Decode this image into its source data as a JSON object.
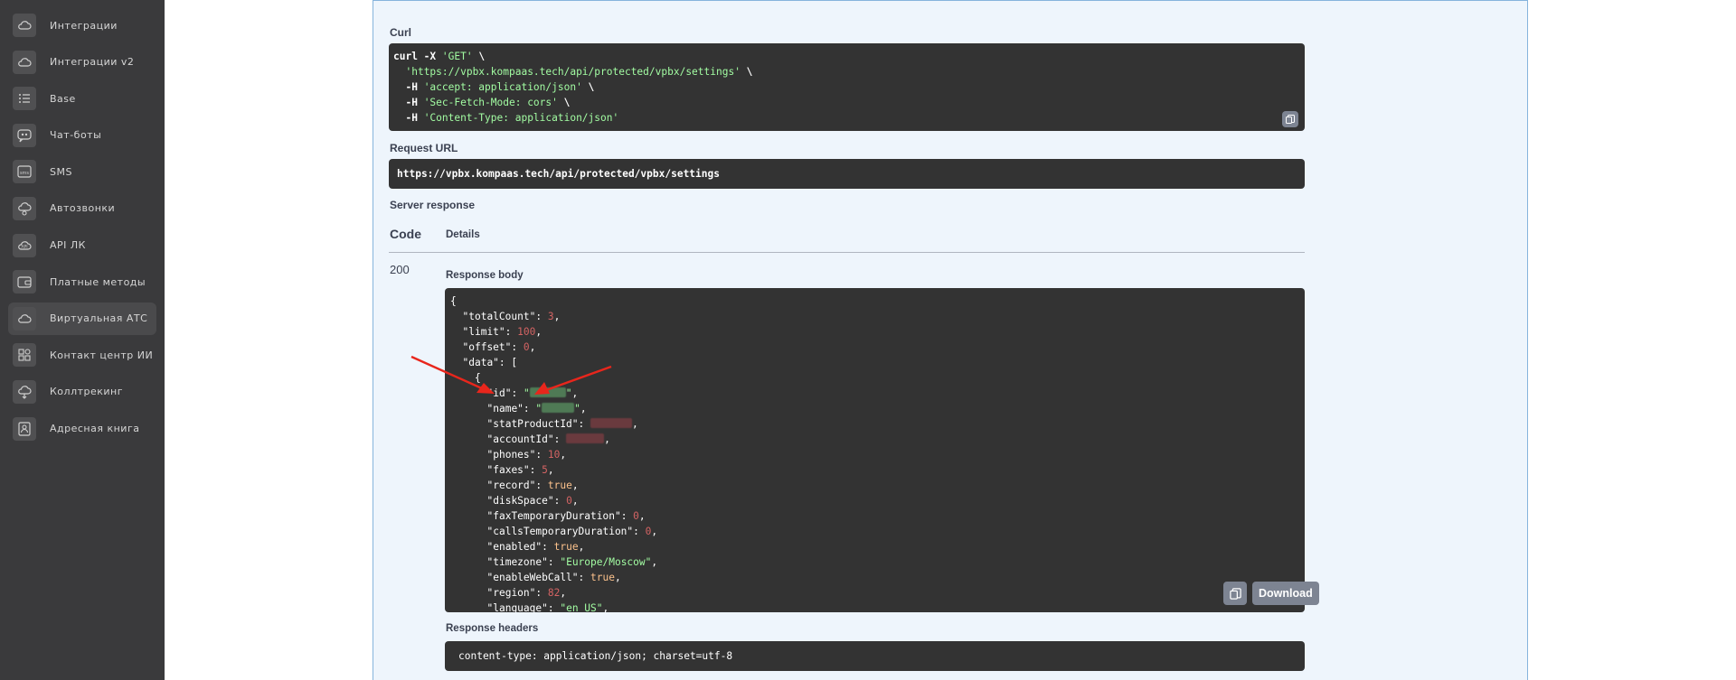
{
  "sidebar": {
    "items": [
      {
        "label": "Интеграции",
        "icon": "cloud-icon",
        "active": false
      },
      {
        "label": "Интеграции v2",
        "icon": "cloud-icon",
        "active": false
      },
      {
        "label": "Base",
        "icon": "list-icon",
        "active": false
      },
      {
        "label": "Чат-боты",
        "icon": "chatbot-icon",
        "active": false
      },
      {
        "label": "SMS",
        "icon": "sms-icon",
        "active": false
      },
      {
        "label": "Автозвонки",
        "icon": "autocall-icon",
        "active": false
      },
      {
        "label": "API ЛК",
        "icon": "api-icon",
        "active": false
      },
      {
        "label": "Платные методы",
        "icon": "wallet-icon",
        "active": false
      },
      {
        "label": "Виртуальная АТС",
        "icon": "cloud-icon",
        "active": true
      },
      {
        "label": "Контакт центр ИИ",
        "icon": "grid-icon",
        "active": false
      },
      {
        "label": "Коллтрекинг",
        "icon": "cloud-tracking-icon",
        "active": false
      },
      {
        "label": "Адресная книга",
        "icon": "address-book-icon",
        "active": false
      }
    ]
  },
  "curl": {
    "label": "Curl",
    "lines": [
      [
        "curl -X ",
        "'GET'",
        " \\"
      ],
      [
        "  ",
        "'https://vpbx.kompaas.tech/api/protected/vpbx/settings'",
        " \\"
      ],
      [
        "  -H ",
        "'accept: application/json'",
        " \\"
      ],
      [
        "  -H ",
        "'Sec-Fetch-Mode: cors'",
        " \\"
      ],
      [
        "  -H ",
        "'Content-Type: application/json'",
        ""
      ]
    ]
  },
  "request_url": {
    "label": "Request URL",
    "value": "https://vpbx.kompaas.tech/api/protected/vpbx/settings"
  },
  "server_response": {
    "label": "Server response",
    "code_header": "Code",
    "details_header": "Details",
    "code": "200",
    "response_body_label": "Response body",
    "download_label": "Download",
    "body_lines": [
      {
        "indent": 0,
        "parts": [
          [
            "p",
            "{"
          ]
        ]
      },
      {
        "indent": 2,
        "parts": [
          [
            "k",
            "\"totalCount\""
          ],
          [
            "p",
            ": "
          ],
          [
            "n",
            "3"
          ],
          [
            "p",
            ","
          ]
        ]
      },
      {
        "indent": 2,
        "parts": [
          [
            "k",
            "\"limit\""
          ],
          [
            "p",
            ": "
          ],
          [
            "n",
            "100"
          ],
          [
            "p",
            ","
          ]
        ]
      },
      {
        "indent": 2,
        "parts": [
          [
            "k",
            "\"offset\""
          ],
          [
            "p",
            ": "
          ],
          [
            "n",
            "0"
          ],
          [
            "p",
            ","
          ]
        ]
      },
      {
        "indent": 2,
        "parts": [
          [
            "k",
            "\"data\""
          ],
          [
            "p",
            ": ["
          ]
        ]
      },
      {
        "indent": 4,
        "parts": [
          [
            "p",
            "{"
          ]
        ]
      },
      {
        "indent": 6,
        "parts": [
          [
            "k",
            "\"id\""
          ],
          [
            "p",
            ": "
          ],
          [
            "s",
            "\""
          ],
          [
            "rg",
            "40"
          ],
          [
            "s",
            "\""
          ],
          [
            "p",
            ","
          ]
        ]
      },
      {
        "indent": 6,
        "parts": [
          [
            "k",
            "\"name\""
          ],
          [
            "p",
            ": "
          ],
          [
            "s",
            "\""
          ],
          [
            "rg",
            "36"
          ],
          [
            "s",
            "\""
          ],
          [
            "p",
            ","
          ]
        ]
      },
      {
        "indent": 6,
        "parts": [
          [
            "k",
            "\"statProductId\""
          ],
          [
            "p",
            ": "
          ],
          [
            "rr",
            "46"
          ],
          [
            "p",
            ","
          ]
        ]
      },
      {
        "indent": 6,
        "parts": [
          [
            "k",
            "\"accountId\""
          ],
          [
            "p",
            ": "
          ],
          [
            "rr",
            "42"
          ],
          [
            "p",
            ","
          ]
        ]
      },
      {
        "indent": 6,
        "parts": [
          [
            "k",
            "\"phones\""
          ],
          [
            "p",
            ": "
          ],
          [
            "n",
            "10"
          ],
          [
            "p",
            ","
          ]
        ]
      },
      {
        "indent": 6,
        "parts": [
          [
            "k",
            "\"faxes\""
          ],
          [
            "p",
            ": "
          ],
          [
            "n",
            "5"
          ],
          [
            "p",
            ","
          ]
        ]
      },
      {
        "indent": 6,
        "parts": [
          [
            "k",
            "\"record\""
          ],
          [
            "p",
            ": "
          ],
          [
            "b",
            "true"
          ],
          [
            "p",
            ","
          ]
        ]
      },
      {
        "indent": 6,
        "parts": [
          [
            "k",
            "\"diskSpace\""
          ],
          [
            "p",
            ": "
          ],
          [
            "n",
            "0"
          ],
          [
            "p",
            ","
          ]
        ]
      },
      {
        "indent": 6,
        "parts": [
          [
            "k",
            "\"faxTemporaryDuration\""
          ],
          [
            "p",
            ": "
          ],
          [
            "n",
            "0"
          ],
          [
            "p",
            ","
          ]
        ]
      },
      {
        "indent": 6,
        "parts": [
          [
            "k",
            "\"callsTemporaryDuration\""
          ],
          [
            "p",
            ": "
          ],
          [
            "n",
            "0"
          ],
          [
            "p",
            ","
          ]
        ]
      },
      {
        "indent": 6,
        "parts": [
          [
            "k",
            "\"enabled\""
          ],
          [
            "p",
            ": "
          ],
          [
            "b",
            "true"
          ],
          [
            "p",
            ","
          ]
        ]
      },
      {
        "indent": 6,
        "parts": [
          [
            "k",
            "\"timezone\""
          ],
          [
            "p",
            ": "
          ],
          [
            "s",
            "\"Europe/Moscow\""
          ],
          [
            "p",
            ","
          ]
        ]
      },
      {
        "indent": 6,
        "parts": [
          [
            "k",
            "\"enableWebCall\""
          ],
          [
            "p",
            ": "
          ],
          [
            "b",
            "true"
          ],
          [
            "p",
            ","
          ]
        ]
      },
      {
        "indent": 6,
        "parts": [
          [
            "k",
            "\"region\""
          ],
          [
            "p",
            ": "
          ],
          [
            "n",
            "82"
          ],
          [
            "p",
            ","
          ]
        ]
      },
      {
        "indent": 6,
        "parts": [
          [
            "k",
            "\"language\""
          ],
          [
            "p",
            ": "
          ],
          [
            "s",
            "\"en_US\""
          ],
          [
            "p",
            ","
          ]
        ]
      }
    ],
    "response_headers_label": "Response headers",
    "response_headers_value": "content-type: application/json; charset=utf-8"
  },
  "colors": {
    "sidebar_bg": "#3a3a3c",
    "panel_bg": "#eef5fc",
    "code_bg": "#333333",
    "string": "#a2fca2",
    "number": "#d36363",
    "boolean": "#fcc28c",
    "annotation_arrow": "#e8261c"
  }
}
